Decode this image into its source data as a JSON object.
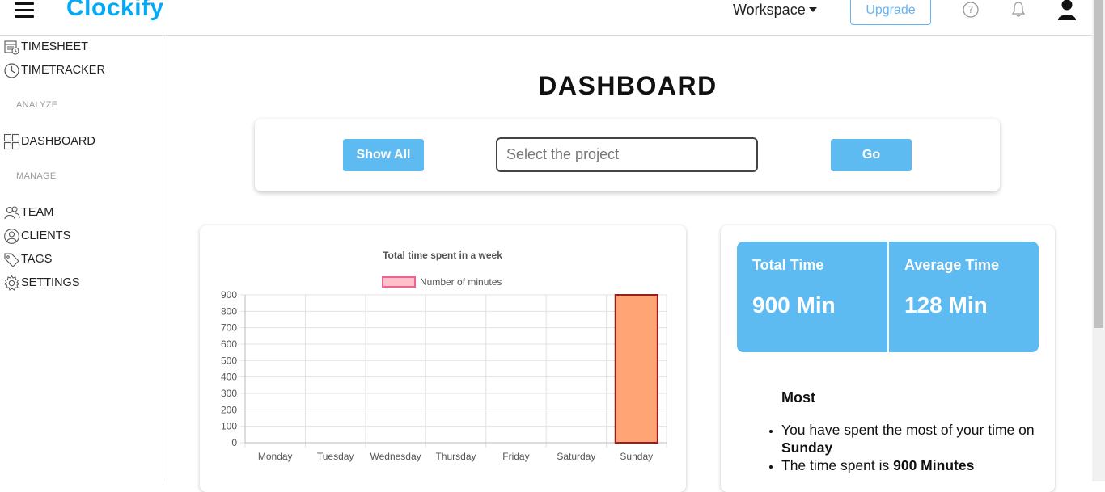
{
  "header": {
    "logo_text": "Clockify",
    "workspace_label": "Workspace",
    "upgrade_label": "Upgrade"
  },
  "sidebar": {
    "items_top": [
      {
        "label": "TIMESHEET",
        "icon": "timesheet-icon"
      },
      {
        "label": "TIMETRACKER",
        "icon": "clock-icon"
      }
    ],
    "analyze_label": "ANALYZE",
    "analyze_items": [
      {
        "label": "DASHBOARD",
        "icon": "dashboard-icon"
      }
    ],
    "manage_label": "MANAGE",
    "manage_items": [
      {
        "label": "TEAM",
        "icon": "team-icon"
      },
      {
        "label": "CLIENTS",
        "icon": "clients-icon"
      },
      {
        "label": "TAGS",
        "icon": "tag-icon"
      },
      {
        "label": "SETTINGS",
        "icon": "gear-icon"
      }
    ]
  },
  "main": {
    "title": "DASHBOARD",
    "filter": {
      "show_all_label": "Show All",
      "project_placeholder": "Select the project",
      "go_label": "Go"
    },
    "stats": {
      "total_label": "Total Time",
      "total_value": "900 Min",
      "average_label": "Average Time",
      "average_value": "128 Min"
    },
    "most": {
      "title": "Most",
      "line1_prefix": "You have spent the most of your time on ",
      "line1_day": "Sunday",
      "line2_prefix": "The time spent is ",
      "line2_value": "900 Minutes"
    }
  },
  "colors": {
    "accent": "#5ebbf1",
    "brand": "#03a9f4",
    "bar_fill": "#ffa474",
    "bar_border": "#9b1c1c",
    "legend_fill": "#ffc0cb",
    "legend_border": "#f06292"
  },
  "chart_data": {
    "type": "bar",
    "title": "Total time spent in a week",
    "categories": [
      "Monday",
      "Tuesday",
      "Wednesday",
      "Thursday",
      "Friday",
      "Saturday",
      "Sunday"
    ],
    "series": [
      {
        "name": "Number of minutes",
        "values": [
          0,
          0,
          0,
          0,
          0,
          0,
          900
        ]
      }
    ],
    "ylim": [
      0,
      900
    ],
    "yticks": [
      0,
      100,
      200,
      300,
      400,
      500,
      600,
      700,
      800,
      900
    ],
    "grid": true,
    "legend": "top"
  }
}
